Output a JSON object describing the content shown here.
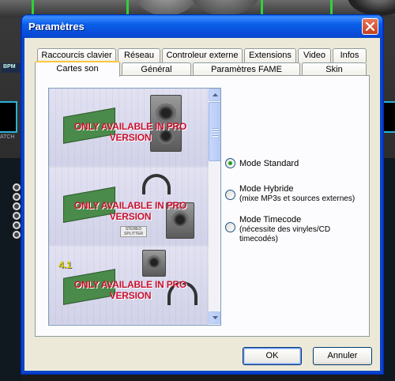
{
  "window": {
    "title": "Paramètres"
  },
  "background": {
    "bpm_label": "BPM",
    "scratch_label": "ATCH"
  },
  "tabs": {
    "row1": [
      "Raccourcis clavier",
      "Réseau",
      "Controleur externe",
      "Extensions",
      "Video",
      "Infos"
    ],
    "row2": [
      "Cartes son",
      "Général",
      "Paramètres FAME",
      "Skin"
    ],
    "active": "Cartes son"
  },
  "sound_cards": {
    "pro_banner": "ONLY AVAILABLE IN PRO VERSION",
    "splitter_text": "STEREO SPLITTER",
    "quad_label": "4.1",
    "options": [
      {
        "label": "Mode Standard",
        "sub": [],
        "checked": true
      },
      {
        "label": "Mode Hybride",
        "sub": [
          "(mixe MP3s et sources externes)"
        ],
        "checked": false
      },
      {
        "label": "Mode Timecode",
        "sub": [
          "(nécessite des vinyles/CD",
          "timecodés)"
        ],
        "checked": false
      }
    ]
  },
  "buttons": {
    "ok": "OK",
    "cancel": "Annuler"
  }
}
